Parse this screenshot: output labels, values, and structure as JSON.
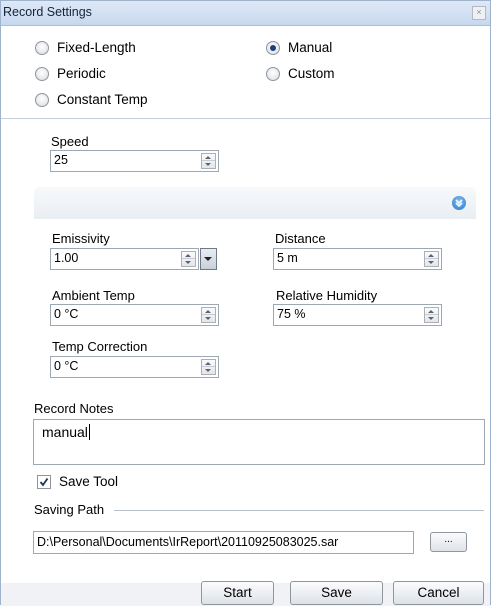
{
  "window": {
    "title": "Record Settings",
    "close_glyph": "×"
  },
  "mode_options": [
    {
      "label": "Fixed-Length",
      "selected": false
    },
    {
      "label": "Periodic",
      "selected": false
    },
    {
      "label": "Constant Temp",
      "selected": false
    },
    {
      "label": "Manual",
      "selected": true
    },
    {
      "label": "Custom",
      "selected": false
    }
  ],
  "speed": {
    "label": "Speed",
    "value": "25"
  },
  "params": {
    "emissivity": {
      "label": "Emissivity",
      "value": "1.00"
    },
    "distance": {
      "label": "Distance",
      "value": "5 m"
    },
    "ambient_temp": {
      "label": "Ambient Temp",
      "value": "0 °C"
    },
    "relative_humidity": {
      "label": "Relative Humidity",
      "value": "75 %"
    },
    "temp_correction": {
      "label": "Temp Correction",
      "value": "0 °C"
    }
  },
  "notes": {
    "label": "Record Notes",
    "value": "manual"
  },
  "save_tool": {
    "label": "Save Tool",
    "checked": true
  },
  "saving_path": {
    "label": "Saving Path",
    "value": "D:\\Personal\\Documents\\IrReport\\20110925083025.sar",
    "browse_label": "..."
  },
  "buttons": {
    "start": "Start",
    "save": "Save",
    "cancel": "Cancel"
  },
  "icons": {
    "expander": "chevron-down-circle-icon",
    "close": "close-icon"
  },
  "colors": {
    "title_bar": "#c6d8ee",
    "radio_selected": "#1b3f7a",
    "expander_icon": "#2b79c9"
  }
}
